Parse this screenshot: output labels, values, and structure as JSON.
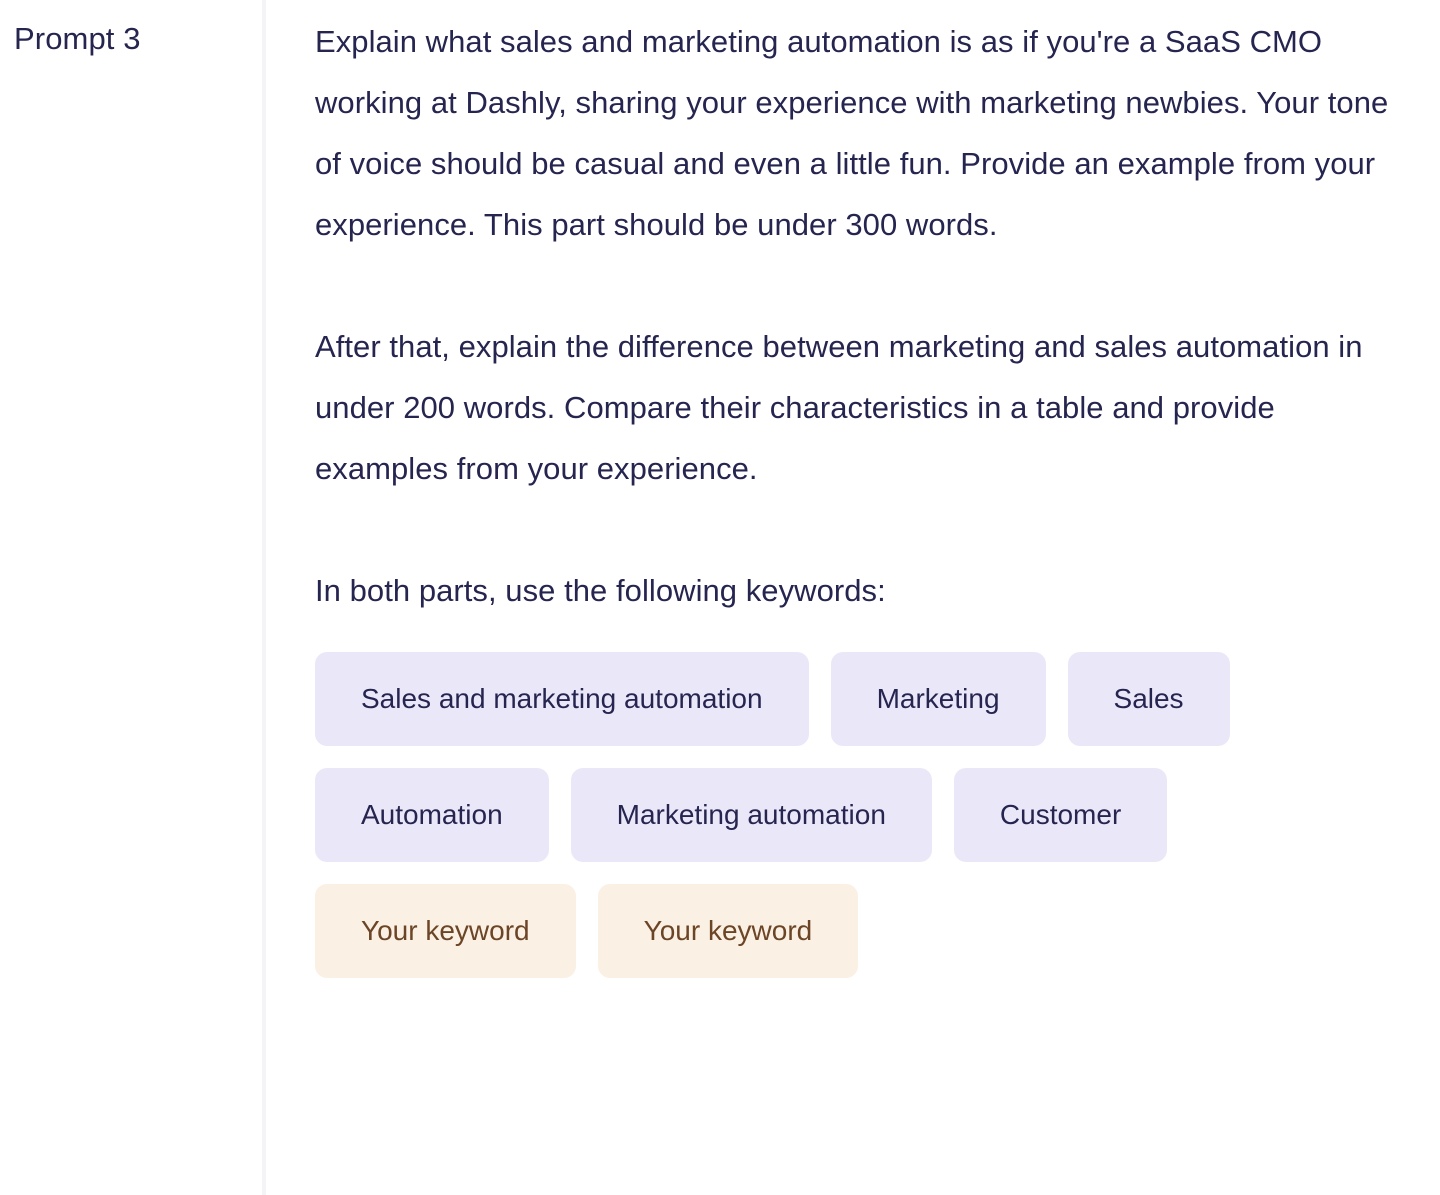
{
  "prompt": {
    "label": "Prompt 3",
    "paragraphs": [
      "Explain what sales and marketing automation is as if you're a SaaS CMO working at Dashly, sharing your experience with marketing newbies. Your tone of voice should be casual and even a little fun. Provide an example from your experience. This part should be under 300 words.",
      "After that, explain the difference between marketing and sales automation in under 200 words. Compare their characteristics in a table and provide examples from your experience.",
      "In both parts, use the following keywords:"
    ]
  },
  "keywords": [
    {
      "label": "Sales and marketing automation",
      "type": "preset"
    },
    {
      "label": "Marketing",
      "type": "preset"
    },
    {
      "label": "Sales",
      "type": "preset"
    },
    {
      "label": "Automation",
      "type": "preset"
    },
    {
      "label": "Marketing automation",
      "type": "preset"
    },
    {
      "label": "Customer",
      "type": "preset"
    },
    {
      "label": "Your keyword",
      "type": "custom"
    },
    {
      "label": "Your keyword",
      "type": "custom"
    }
  ],
  "colors": {
    "text": "#262550",
    "chip_preset_bg": "#eae8f8",
    "chip_preset_text": "#262550",
    "chip_custom_bg": "#faf0e4",
    "chip_custom_text": "#6b4526",
    "divider": "#f4f4f6",
    "page_bg": "#ffffff"
  }
}
